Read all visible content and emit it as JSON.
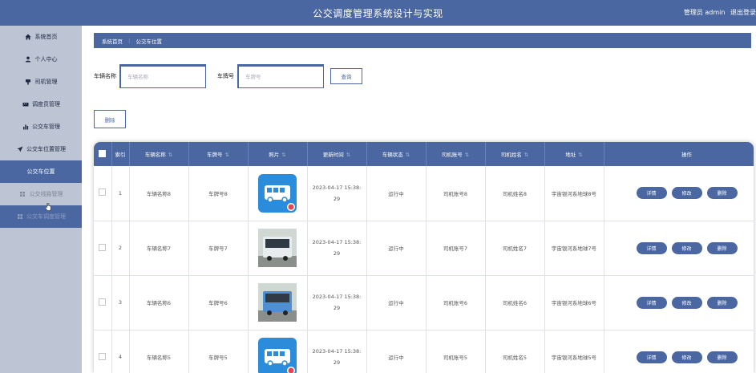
{
  "header": {
    "title": "公交调度管理系统设计与实现",
    "user": "管理员 admin",
    "logout": "退出登录"
  },
  "sidebar": {
    "items": [
      {
        "label": "系统首页",
        "icon": "home-icon"
      },
      {
        "label": "个人中心",
        "icon": "user-icon"
      },
      {
        "label": "司机管理",
        "icon": "driver-icon"
      },
      {
        "label": "调度员管理",
        "icon": "dispatcher-icon"
      },
      {
        "label": "公交车管理",
        "icon": "bar-chart-icon"
      },
      {
        "label": "公交车位置管理",
        "icon": "send-icon"
      }
    ],
    "active_sub": "公交车位置",
    "dim_item": "公交线路管理",
    "sub_item": "公交车调度管理"
  },
  "breadcrumb": {
    "home": "系统首页",
    "separator": "⋮",
    "current": "公交车位置"
  },
  "search": {
    "name_label": "车辆名称",
    "name_placeholder": "车辆名称",
    "plate_label": "车牌号",
    "plate_placeholder": "车牌号",
    "query_label": "查询"
  },
  "toolbar": {
    "delete_label": "删除"
  },
  "table": {
    "columns": [
      "索引",
      "车辆名称",
      "车牌号",
      "照片",
      "更新时间",
      "车辆状态",
      "司机账号",
      "司机姓名",
      "地址",
      "操作"
    ],
    "rows": [
      {
        "index": "1",
        "name": "车辆名称8",
        "plate": "车牌号8",
        "photo": "bus-icon",
        "time1": "2023-04-17 15:38:",
        "time2": "29",
        "status": "运行中",
        "account": "司机账号8",
        "driver": "司机姓名8",
        "address": "宇宙银河系地球8号"
      },
      {
        "index": "2",
        "name": "车辆名称7",
        "plate": "车牌号7",
        "photo": "bus-photo-white",
        "time1": "2023-04-17 15:38:",
        "time2": "29",
        "status": "运行中",
        "account": "司机账号7",
        "driver": "司机姓名7",
        "address": "宇宙银河系地球7号"
      },
      {
        "index": "3",
        "name": "车辆名称6",
        "plate": "车牌号6",
        "photo": "bus-photo-blue",
        "time1": "2023-04-17 15:38:",
        "time2": "29",
        "status": "运行中",
        "account": "司机账号6",
        "driver": "司机姓名6",
        "address": "宇宙银河系地球6号"
      },
      {
        "index": "4",
        "name": "车辆名称5",
        "plate": "车牌号5",
        "photo": "bus-icon",
        "time1": "2023-04-17 15:38:",
        "time2": "29",
        "status": "运行中",
        "account": "司机账号5",
        "driver": "司机姓名5",
        "address": "宇宙银河系地球5号"
      }
    ],
    "ops": {
      "detail": "详情",
      "edit": "修改",
      "delete": "删除"
    }
  },
  "colors": {
    "primary": "#4a67a1",
    "sidebar": "#bdc4d3"
  }
}
